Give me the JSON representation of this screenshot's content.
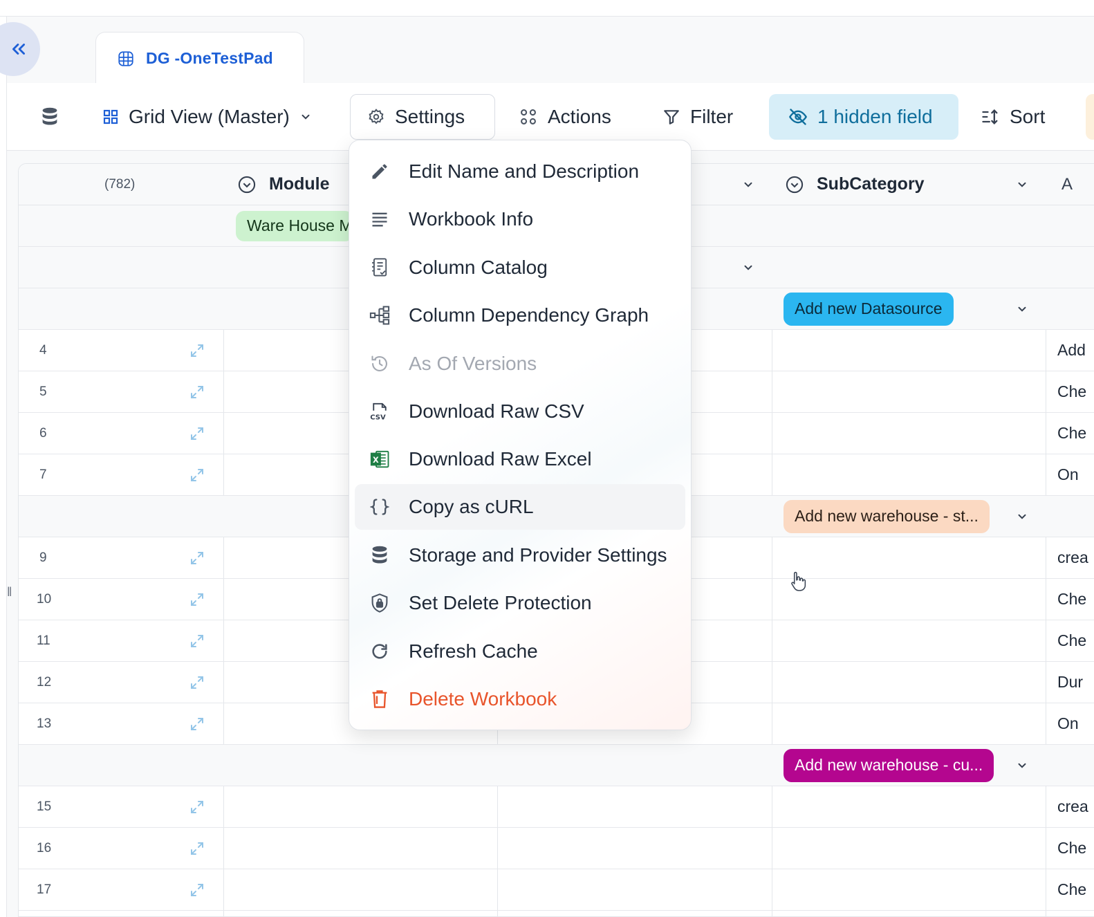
{
  "tab": {
    "label": "DG -OneTestPad"
  },
  "toolbar": {
    "view_label": "Grid View (Master)",
    "settings_label": "Settings",
    "actions_label": "Actions",
    "filter_label": "Filter",
    "hidden_label": "1 hidden field",
    "sort_label": "Sort"
  },
  "grid": {
    "record_count": "(782)",
    "col_module": "Module",
    "col_subcategory": "SubCategory",
    "col_next_partial": "A",
    "module_pill": "Ware House M",
    "rows": [
      {
        "num": "4",
        "right": "Add"
      },
      {
        "num": "5",
        "right": "Che"
      },
      {
        "num": "6",
        "right": "Che"
      },
      {
        "num": "7",
        "right": "On"
      },
      {
        "num": "9",
        "right": "crea"
      },
      {
        "num": "10",
        "right": "Che"
      },
      {
        "num": "11",
        "right": "Che"
      },
      {
        "num": "12",
        "right": "Dur"
      },
      {
        "num": "13",
        "right": "On"
      },
      {
        "num": "15",
        "right": "crea"
      },
      {
        "num": "16",
        "right": "Che"
      },
      {
        "num": "17",
        "right": "Che"
      }
    ],
    "group_pills": [
      {
        "label": "Add new Datasource",
        "bg": "#2bb6f0",
        "color": "#0b2a3a"
      },
      {
        "label": "Add new warehouse - st...",
        "bg": "#fbd9c2",
        "color": "#2b1f17"
      },
      {
        "label": "Add new warehouse - cu...",
        "bg": "#b4068f",
        "color": "#ffffff"
      }
    ]
  },
  "menu": {
    "items": [
      {
        "label": "Edit Name and Description",
        "icon": "pencil-icon"
      },
      {
        "label": "Workbook Info",
        "icon": "lines-icon"
      },
      {
        "label": "Column Catalog",
        "icon": "catalog-icon"
      },
      {
        "label": "Column Dependency Graph",
        "icon": "dependency-graph-icon"
      },
      {
        "label": "As Of Versions",
        "icon": "history-icon",
        "state": "disabled"
      },
      {
        "label": "Download Raw CSV",
        "icon": "csv-file-icon"
      },
      {
        "label": "Download Raw Excel",
        "icon": "excel-icon"
      },
      {
        "label": "Copy as cURL",
        "icon": "braces-icon",
        "state": "hover"
      },
      {
        "label": "Storage and Provider Settings",
        "icon": "database-icon"
      },
      {
        "label": "Set Delete Protection",
        "icon": "shield-lock-icon"
      },
      {
        "label": "Refresh Cache",
        "icon": "refresh-icon"
      },
      {
        "label": "Delete Workbook",
        "icon": "trash-icon",
        "state": "danger"
      }
    ]
  },
  "colors": {
    "accent": "#1d5fd6",
    "danger": "#e8542b",
    "hidden_bg": "#d7eef8"
  }
}
